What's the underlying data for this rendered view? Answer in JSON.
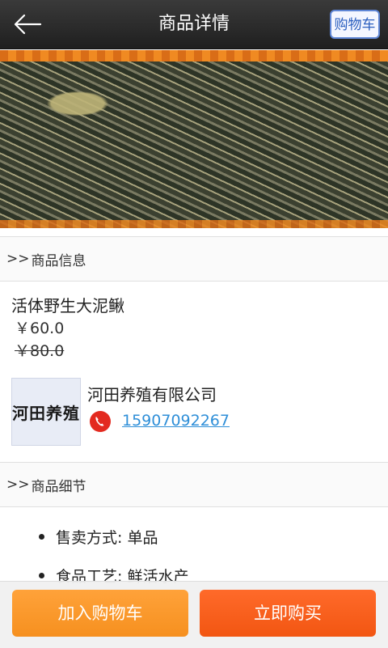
{
  "header": {
    "title": "商品详情",
    "cart_label": "购物车"
  },
  "sections": {
    "info_title": "商品信息",
    "detail_title": "商品细节"
  },
  "product": {
    "name": "活体野生大泥鳅",
    "price": "￥60.0",
    "original_price": "￥80.0"
  },
  "seller": {
    "logo_text": "河田养殖",
    "company": "河田养殖有限公司",
    "phone": "15907092267"
  },
  "details": [
    "售卖方式: 单品",
    "食品工艺: 鲜活水产"
  ],
  "actions": {
    "add_to_cart": "加入购物车",
    "buy_now": "立即购买"
  }
}
